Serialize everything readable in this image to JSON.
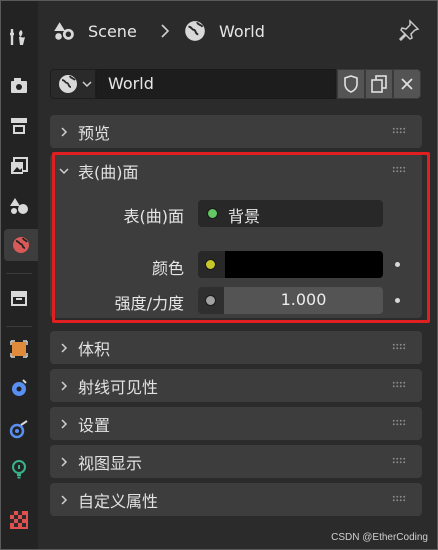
{
  "breadcrumb": {
    "scene": "Scene",
    "world": "World"
  },
  "datablock": {
    "name": "World"
  },
  "panels": {
    "preview": "预览",
    "surface": "表(曲)面",
    "volume": "体积",
    "ray_visibility": "射线可见性",
    "settings": "设置",
    "viewport_display": "视图显示",
    "custom_props": "自定义属性"
  },
  "surface": {
    "surface_label": "表(曲)面",
    "surface_value": "背景",
    "color_label": "颜色",
    "color_value": "#000000",
    "strength_label": "强度/力度",
    "strength_value": "1.000"
  },
  "colors": {
    "socket_green": "#63c763",
    "socket_yellow": "#c7c729",
    "socket_grey": "#a1a1a1",
    "highlight_red": "#e02020"
  },
  "icons": {
    "tabs": [
      "tool-icon",
      "render-icon",
      "output-icon",
      "view-layer-icon",
      "scene-icon",
      "world-icon",
      "collection-icon",
      "object-icon",
      "modifier-icon",
      "particles-icon",
      "physics-icon",
      "texture-icon"
    ]
  },
  "watermark": "CSDN @EtherCoding"
}
